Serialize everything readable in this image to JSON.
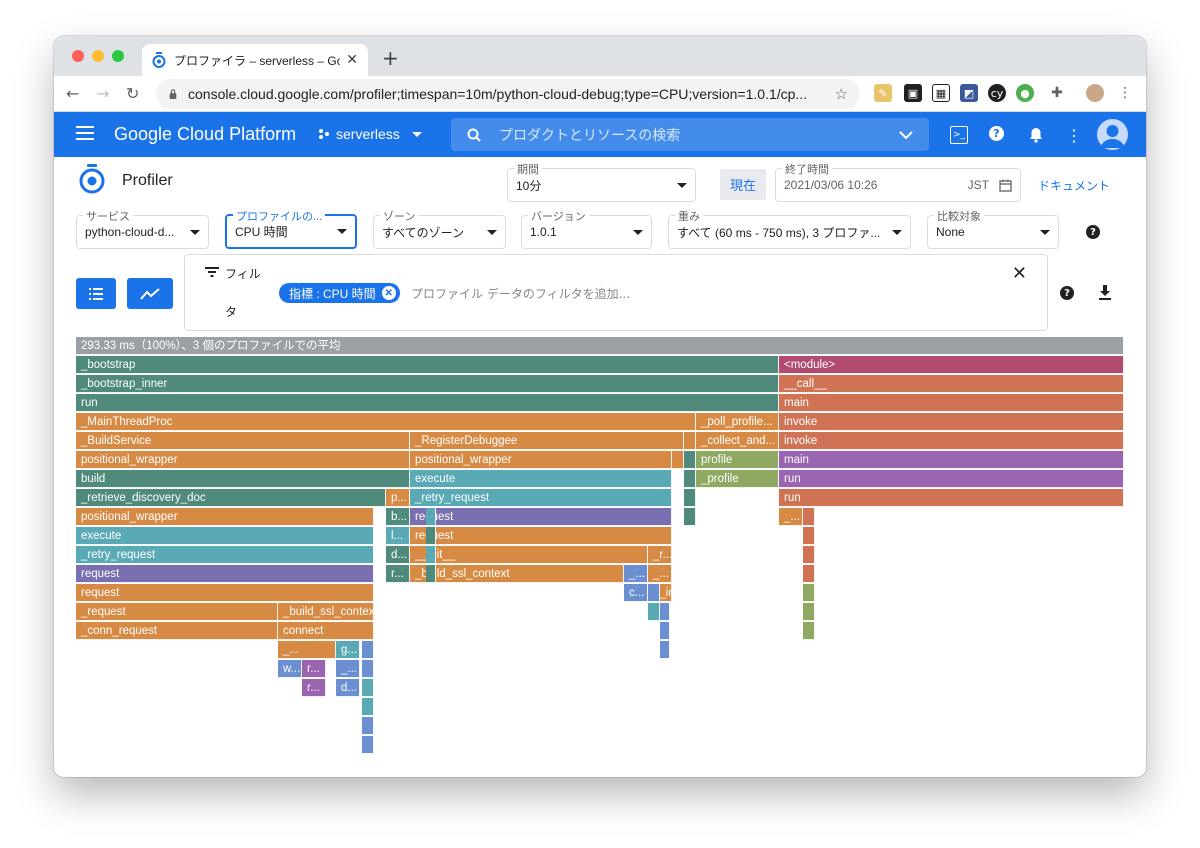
{
  "browser": {
    "tab_title": "プロファイラ – serverless – Goo",
    "url": "console.cloud.google.com/profiler;timespan=10m/python-cloud-debug;type=CPU;version=1.0.1/cp..."
  },
  "header": {
    "brand": "Google Cloud Platform",
    "project": "serverless",
    "search_placeholder": "プロダクトとリソースの検索"
  },
  "page": {
    "title": "Profiler",
    "period_label": "期間",
    "period_value": "10分",
    "now_button": "現在",
    "end_time_label": "終了時間",
    "end_time_value": "2021/03/06 10:26",
    "timezone": "JST",
    "docs_link": "ドキュメント"
  },
  "filters": {
    "service": {
      "label": "サービス",
      "value": "python-cloud-d..."
    },
    "profile_type": {
      "label": "プロファイルの...",
      "value": "CPU 時間"
    },
    "zone": {
      "label": "ゾーン",
      "value": "すべてのゾーン"
    },
    "version": {
      "label": "バージョン",
      "value": "1.0.1"
    },
    "weight": {
      "label": "重み",
      "value": "すべて (60 ms - 750 ms), 3 プロファ..."
    },
    "compare": {
      "label": "比較対象",
      "value": "None"
    }
  },
  "filter_panel": {
    "label_line1": "フィル",
    "label_line2": "タ",
    "chip": "指標 : CPU 時間",
    "placeholder": "プロファイル データのフィルタを追加..."
  },
  "flame": {
    "summary": "293.33 ms（100%）、3 個のプロファイルでの平均",
    "frames": [
      {
        "name": "_bootstrap",
        "color": "#4f8a7d"
      },
      {
        "name": "<module>",
        "color": "#b04a6e"
      },
      {
        "name": "_bootstrap_inner",
        "color": "#4f8a7d"
      },
      {
        "name": "__call__",
        "color": "#cf7354"
      },
      {
        "name": "run",
        "color": "#4f8a7d"
      },
      {
        "name": "main",
        "color": "#cf7354"
      },
      {
        "name": "_MainThreadProc",
        "color": "#d78a44"
      },
      {
        "name": "_poll_profile...",
        "color": "#d78a44"
      },
      {
        "name": "invoke",
        "color": "#cf7354"
      },
      {
        "name": "_BuildService",
        "color": "#d78a44"
      },
      {
        "name": "_RegisterDebuggee",
        "color": "#d78a44"
      },
      {
        "name": "_collect_and...",
        "color": "#d78a44"
      },
      {
        "name": "invoke",
        "color": "#cf7354"
      },
      {
        "name": "positional_wrapper",
        "color": "#d78a44"
      },
      {
        "name": "positional_wrapper",
        "color": "#d78a44"
      },
      {
        "name": "profile",
        "color": "#8fa862"
      },
      {
        "name": "main",
        "color": "#9a64b0"
      },
      {
        "name": "build",
        "color": "#4f8a7d"
      },
      {
        "name": "execute",
        "color": "#5aaab5"
      },
      {
        "name": "_profile",
        "color": "#8fa862"
      },
      {
        "name": "run",
        "color": "#9a64b0"
      },
      {
        "name": "_retrieve_discovery_doc",
        "color": "#4f8a7d"
      },
      {
        "name": "p...",
        "color": "#d78a44"
      },
      {
        "name": "_retry_request",
        "color": "#5aaab5"
      },
      {
        "name": "run",
        "color": "#cf7354"
      },
      {
        "name": "positional_wrapper",
        "color": "#d78a44"
      },
      {
        "name": "b...",
        "color": "#4f8a7d"
      },
      {
        "name": "request",
        "color": "#7a6fb0"
      },
      {
        "name": "_...",
        "color": "#d78a44"
      },
      {
        "name": "execute",
        "color": "#5aaab5"
      },
      {
        "name": "l...",
        "color": "#5aaab5"
      },
      {
        "name": "request",
        "color": "#d78a44"
      },
      {
        "name": "_retry_request",
        "color": "#5aaab5"
      },
      {
        "name": "d...",
        "color": "#4f8a7d"
      },
      {
        "name": "__init__",
        "color": "#d78a44"
      },
      {
        "name": "_r...",
        "color": "#d78a44"
      },
      {
        "name": "request",
        "color": "#7a6fb0"
      },
      {
        "name": "r...",
        "color": "#4f8a7d"
      },
      {
        "name": "_build_ssl_context",
        "color": "#d78a44"
      },
      {
        "name": "_...",
        "color": "#6b8fd0"
      },
      {
        "name": "_...",
        "color": "#d78a44"
      },
      {
        "name": "request",
        "color": "#d78a44"
      },
      {
        "name": "c...",
        "color": "#6b8fd0"
      },
      {
        "name": "__init__",
        "color": "#d78a44"
      },
      {
        "name": "_request",
        "color": "#d78a44"
      },
      {
        "name": "_build_ssl_context",
        "color": "#d78a44"
      },
      {
        "name": "_conn_request",
        "color": "#d78a44"
      },
      {
        "name": "connect",
        "color": "#d78a44"
      },
      {
        "name": "_...",
        "color": "#d78a44"
      },
      {
        "name": "g...",
        "color": "#5aaab5"
      },
      {
        "name": "w...",
        "color": "#6b8fd0"
      },
      {
        "name": "r...",
        "color": "#9a64b0"
      },
      {
        "name": "_...",
        "color": "#6b8fd0"
      },
      {
        "name": "r...",
        "color": "#9a64b0"
      },
      {
        "name": "d...",
        "color": "#6b8fd0"
      }
    ]
  }
}
